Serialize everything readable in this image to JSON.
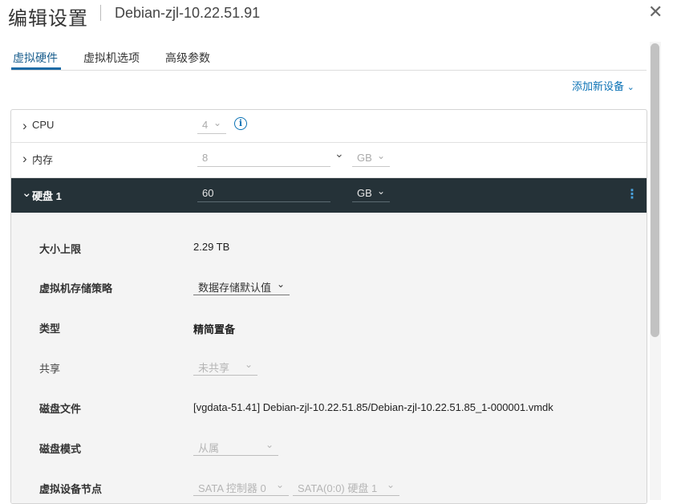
{
  "header": {
    "title": "编辑设置",
    "vm_name": "Debian-zjl-10.22.51.91",
    "close_glyph": "✕"
  },
  "tabs": [
    {
      "label": "虚拟硬件",
      "active": true
    },
    {
      "label": "虚拟机选项",
      "active": false
    },
    {
      "label": "高级参数",
      "active": false
    }
  ],
  "add_device": {
    "label": "添加新设备",
    "arrow": "⌄"
  },
  "hardware": {
    "cpu": {
      "label": "CPU",
      "value": "4",
      "info": "i"
    },
    "memory": {
      "label": "内存",
      "value": "8",
      "unit": "GB"
    },
    "disk": {
      "label": "硬盘 1",
      "value": "60",
      "unit": "GB",
      "menu": "⋮"
    }
  },
  "disk_details": [
    {
      "label": "大小上限",
      "value": "2.29 TB"
    },
    {
      "label": "虚拟机存储策略",
      "value": "数据存储默认值"
    },
    {
      "label": "类型",
      "value": "精简置备"
    },
    {
      "label": "共享",
      "value": "未共享"
    },
    {
      "label": "磁盘文件",
      "value": "[vgdata-51.41] Debian-zjl-10.22.51.85/Debian-zjl-10.22.51.85_1-000001.vmdk"
    },
    {
      "label": "磁盘模式",
      "value": "从属"
    },
    {
      "label": "虚拟设备节点",
      "controller": "SATA 控制器 0",
      "node": "SATA(0:0) 硬盘 1"
    }
  ],
  "glyphs": {
    "chevron_right": "›",
    "chevron_down": "⌄",
    "select_arrow": "⌵"
  },
  "colors": {
    "accent": "#0b72b5",
    "disk_header_bg": "#253238"
  }
}
